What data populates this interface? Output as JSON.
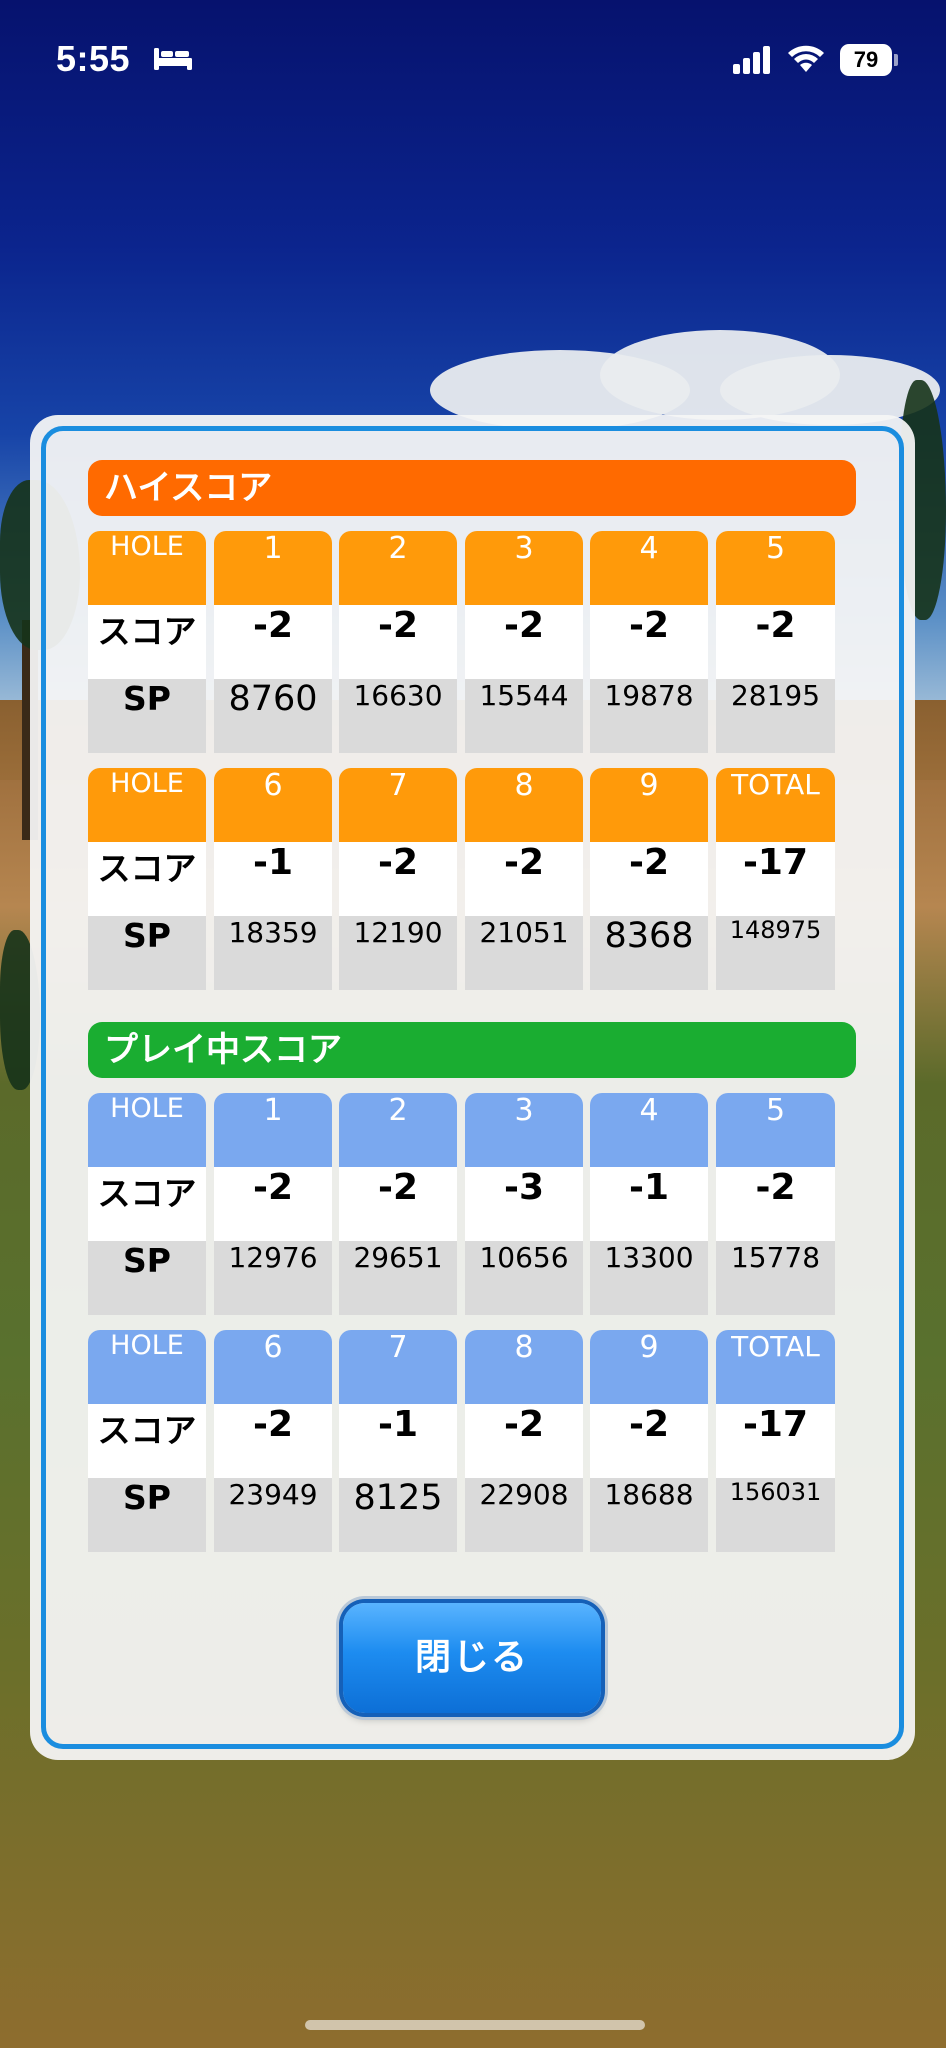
{
  "status_bar": {
    "time": "5:55",
    "battery": "79",
    "icons": [
      "bed-icon",
      "signal-icon",
      "wifi-icon",
      "battery-icon"
    ]
  },
  "high_score": {
    "title": "ハイスコア",
    "color": "#ff6a00",
    "header_color": "#ff9a0a",
    "blocks": [
      {
        "hole_label": "HOLE",
        "holes": [
          "1",
          "2",
          "3",
          "4",
          "5"
        ],
        "score_label": "スコア",
        "scores": [
          "-2",
          "-2",
          "-2",
          "-2",
          "-2"
        ],
        "sp_label": "SP",
        "sp": [
          "8760",
          "16630",
          "15544",
          "19878",
          "28195"
        ]
      },
      {
        "hole_label": "HOLE",
        "holes": [
          "6",
          "7",
          "8",
          "9",
          "TOTAL"
        ],
        "score_label": "スコア",
        "scores": [
          "-1",
          "-2",
          "-2",
          "-2",
          "-17"
        ],
        "sp_label": "SP",
        "sp": [
          "18359",
          "12190",
          "21051",
          "8368",
          "148975"
        ]
      }
    ]
  },
  "playing_score": {
    "title": "プレイ中スコア",
    "color": "#1aad31",
    "header_color": "#7aa8ef",
    "blocks": [
      {
        "hole_label": "HOLE",
        "holes": [
          "1",
          "2",
          "3",
          "4",
          "5"
        ],
        "score_label": "スコア",
        "scores": [
          "-2",
          "-2",
          "-3",
          "-1",
          "-2"
        ],
        "sp_label": "SP",
        "sp": [
          "12976",
          "29651",
          "10656",
          "13300",
          "15778"
        ]
      },
      {
        "hole_label": "HOLE",
        "holes": [
          "6",
          "7",
          "8",
          "9",
          "TOTAL"
        ],
        "score_label": "スコア",
        "scores": [
          "-2",
          "-1",
          "-2",
          "-2",
          "-17"
        ],
        "sp_label": "SP",
        "sp": [
          "23949",
          "8125",
          "22908",
          "18688",
          "156031"
        ]
      }
    ]
  },
  "close_button": {
    "label": "閉じる",
    "color": "#1d8cf0"
  }
}
